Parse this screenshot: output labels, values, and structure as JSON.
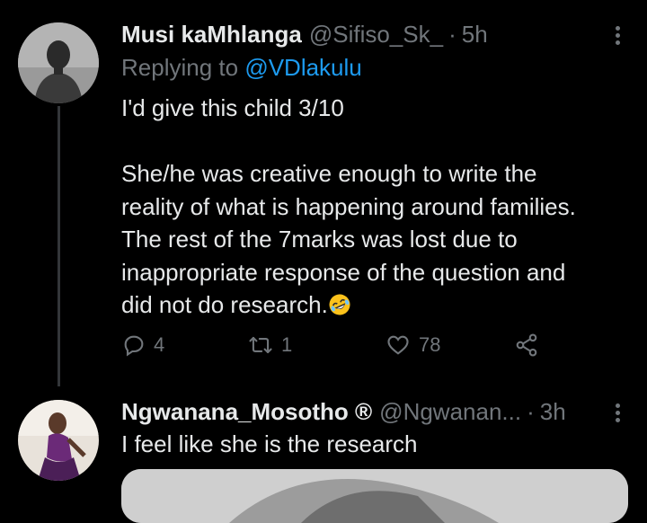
{
  "tweets": [
    {
      "display_name": "Musi kaMhlanga",
      "handle": "@Sifiso_Sk_",
      "separator": "·",
      "time": "5h",
      "replying_prefix": "Replying to ",
      "replying_to": "@VDlakulu",
      "text_lines": [
        "I'd give this child 3/10",
        "",
        "She/he was creative enough to write the",
        "reality of what is happening around families.",
        "The rest of the 7marks was lost due to",
        "inappropriate response of the question and",
        "did not do research."
      ],
      "emoji": "rolling-on-floor-laughing",
      "actions": {
        "replies": "4",
        "retweets": "1",
        "likes": "78"
      }
    },
    {
      "display_name": "Ngwanana_Mosotho ®",
      "handle": "@Ngwanan...",
      "separator": "·",
      "time": "3h",
      "text": "I feel like she is the research"
    }
  ],
  "colors": {
    "background": "#000000",
    "text": "#e7e9ea",
    "muted": "#71767b",
    "link": "#1d9bf0"
  }
}
